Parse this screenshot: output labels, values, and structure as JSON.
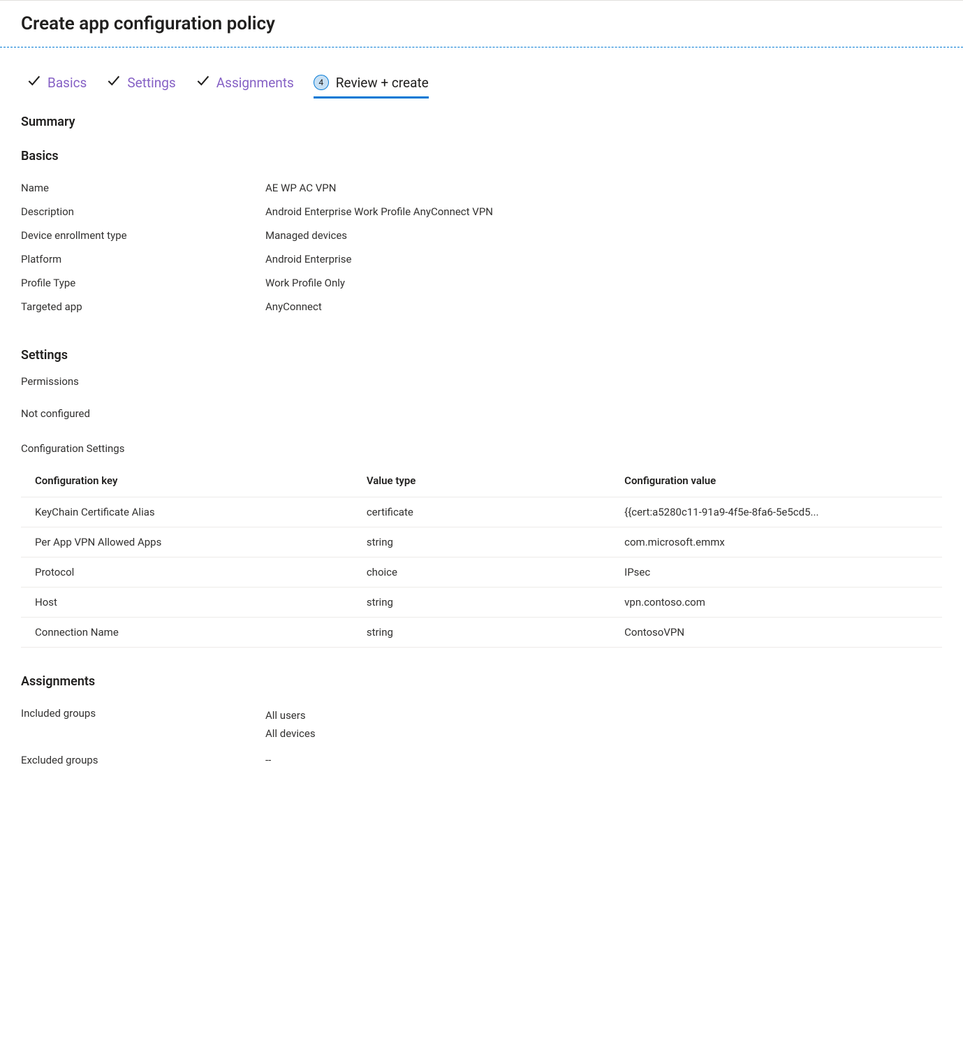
{
  "header": {
    "title": "Create app configuration policy"
  },
  "stepper": {
    "steps": [
      {
        "label": "Basics",
        "state": "completed"
      },
      {
        "label": "Settings",
        "state": "completed"
      },
      {
        "label": "Assignments",
        "state": "completed"
      },
      {
        "label": "Review + create",
        "state": "active",
        "number": "4"
      }
    ]
  },
  "summary": {
    "heading": "Summary"
  },
  "basics": {
    "heading": "Basics",
    "rows": [
      {
        "label": "Name",
        "value": "AE WP AC VPN"
      },
      {
        "label": "Description",
        "value": "Android Enterprise Work Profile AnyConnect VPN"
      },
      {
        "label": "Device enrollment type",
        "value": "Managed devices"
      },
      {
        "label": "Platform",
        "value": "Android Enterprise"
      },
      {
        "label": "Profile Type",
        "value": "Work Profile Only"
      },
      {
        "label": "Targeted app",
        "value": "AnyConnect"
      }
    ]
  },
  "settings": {
    "heading": "Settings",
    "permissions_label": "Permissions",
    "not_configured": "Not configured",
    "config_settings_heading": "Configuration Settings",
    "table": {
      "headers": [
        "Configuration key",
        "Value type",
        "Configuration value"
      ],
      "rows": [
        {
          "key": "KeyChain Certificate Alias",
          "type": "certificate",
          "value": "{{cert:a5280c11-91a9-4f5e-8fa6-5e5cd5..."
        },
        {
          "key": "Per App VPN Allowed Apps",
          "type": "string",
          "value": "com.microsoft.emmx"
        },
        {
          "key": "Protocol",
          "type": "choice",
          "value": "IPsec"
        },
        {
          "key": "Host",
          "type": "string",
          "value": "vpn.contoso.com"
        },
        {
          "key": "Connection Name",
          "type": "string",
          "value": "ContosoVPN"
        }
      ]
    }
  },
  "assignments": {
    "heading": "Assignments",
    "included": {
      "label": "Included groups",
      "values": [
        "All users",
        "All devices"
      ]
    },
    "excluded": {
      "label": "Excluded groups",
      "value": "--"
    }
  }
}
